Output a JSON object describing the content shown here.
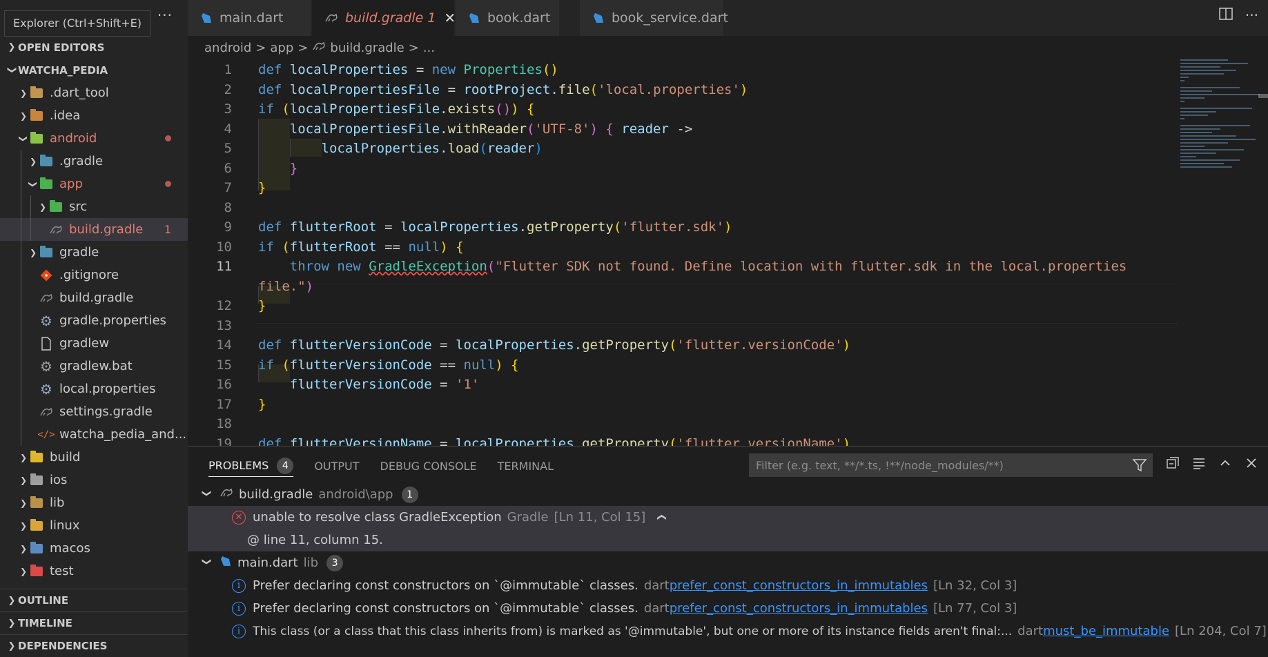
{
  "sidebar": {
    "tooltip": "Explorer (Ctrl+Shift+E)",
    "more": "···",
    "open_editors": "OPEN EDITORS",
    "workspace": "WATCHA_PEDIA",
    "tree": [
      {
        "label": ".dart_tool",
        "icon": "folder-icon"
      },
      {
        "label": ".idea",
        "icon": "folder-idea-icon"
      },
      {
        "label": "android",
        "icon": "folder-android-icon"
      },
      {
        "label": ".gradle",
        "icon": "folder-gradle-icon"
      },
      {
        "label": "app",
        "icon": "folder-app-icon"
      },
      {
        "label": "src",
        "icon": "folder-src-icon"
      },
      {
        "label": "build.gradle",
        "icon": "gradle-file-icon",
        "count": "1"
      },
      {
        "label": "gradle",
        "icon": "folder-gradle-icon"
      },
      {
        "label": ".gitignore",
        "icon": "git-icon"
      },
      {
        "label": "build.gradle",
        "icon": "gradle-file-icon"
      },
      {
        "label": "gradle.properties",
        "icon": "gear-icon"
      },
      {
        "label": "gradlew",
        "icon": "file-icon"
      },
      {
        "label": "gradlew.bat",
        "icon": "gear-icon"
      },
      {
        "label": "local.properties",
        "icon": "gear-icon"
      },
      {
        "label": "settings.gradle",
        "icon": "gradle-file-icon"
      },
      {
        "label": "watcha_pedia_and...",
        "icon": "xml-icon"
      },
      {
        "label": "build",
        "icon": "folder-build-icon"
      },
      {
        "label": "ios",
        "icon": "folder-ios-icon"
      },
      {
        "label": "lib",
        "icon": "folder-lib-icon"
      },
      {
        "label": "linux",
        "icon": "folder-linux-icon"
      },
      {
        "label": "macos",
        "icon": "folder-macos-icon"
      },
      {
        "label": "test",
        "icon": "folder-test-icon"
      }
    ],
    "outline": "OUTLINE",
    "timeline": "TIMELINE",
    "dependencies": "DEPENDENCIES"
  },
  "tabs": [
    {
      "label": "main.dart"
    },
    {
      "label": "build.gradle",
      "count": "1",
      "close": "✕"
    },
    {
      "label": "book.dart"
    },
    {
      "label": "book_service.dart"
    }
  ],
  "breadcrumb": {
    "p1": "android",
    "p2": "app",
    "p3": "build.gradle",
    "p4": "...",
    "sep": ">"
  },
  "editor": {
    "line_numbers": [
      "1",
      "2",
      "3",
      "4",
      "5",
      "6",
      "7",
      "8",
      "9",
      "10",
      "11",
      "12",
      "13",
      "14",
      "15",
      "16",
      "17",
      "18",
      "19"
    ],
    "lines": {
      "l1": [
        "def",
        "localProperties",
        "=",
        "new",
        "Properties",
        "(",
        ")"
      ],
      "l2": [
        "def",
        "localPropertiesFile",
        "=",
        "rootProject",
        ".",
        "file",
        "(",
        "'local.properties'",
        ")"
      ],
      "l3": [
        "if",
        "(",
        "localPropertiesFile",
        ".",
        "exists",
        "(",
        ")",
        ")",
        "{"
      ],
      "l4": [
        "localPropertiesFile",
        ".",
        "withReader",
        "(",
        "'UTF-8'",
        ")",
        "{",
        "reader",
        "->"
      ],
      "l5": [
        "localProperties",
        ".",
        "load",
        "(",
        "reader",
        ")"
      ],
      "l6": [
        "}"
      ],
      "l7": [
        "}"
      ],
      "l9": [
        "def",
        "flutterRoot",
        "=",
        "localProperties",
        ".",
        "getProperty",
        "(",
        "'flutter.sdk'",
        ")"
      ],
      "l10": [
        "if",
        "(",
        "flutterRoot",
        "==",
        "null",
        ")",
        "{"
      ],
      "l11": [
        "throw",
        "new",
        "GradleException",
        "(",
        "\"Flutter SDK not found. Define location with flutter.sdk in the local.properties"
      ],
      "l11b": [
        "file.\"",
        ")"
      ],
      "l12": [
        "}"
      ],
      "l14": [
        "def",
        "flutterVersionCode",
        "=",
        "localProperties",
        ".",
        "getProperty",
        "(",
        "'flutter.versionCode'",
        ")"
      ],
      "l15": [
        "if",
        "(",
        "flutterVersionCode",
        "==",
        "null",
        ")",
        "{"
      ],
      "l16": [
        "flutterVersionCode",
        "=",
        "'1'"
      ],
      "l17": [
        "}"
      ],
      "l19": [
        "def",
        "flutterVersionName",
        "=",
        "localProperties",
        ".",
        "getProperty",
        "(",
        "'flutter.versionName'",
        ")"
      ]
    }
  },
  "panel": {
    "tabs": {
      "problems": "PROBLEMS",
      "problems_count": "4",
      "output": "OUTPUT",
      "debug": "DEBUG CONSOLE",
      "terminal": "TERMINAL"
    },
    "filter_placeholder": "Filter (e.g. text, **/*.ts, !**/node_modules/**)",
    "groups": [
      {
        "file": "build.gradle",
        "path": "android\\app",
        "count": "1"
      },
      {
        "file": "main.dart",
        "path": "lib",
        "count": "3"
      }
    ],
    "problems": [
      {
        "message": "unable to resolve class GradleException",
        "source": "Gradle",
        "location": "[Ln 11, Col 15]",
        "detail": "@ line 11, column 15."
      },
      {
        "message": "Prefer declaring const constructors on `@immutable` classes.",
        "source": "dart",
        "code": "prefer_const_constructors_in_immutables",
        "location": "[Ln 32, Col 3]"
      },
      {
        "message": "Prefer declaring const constructors on `@immutable` classes.",
        "source": "dart",
        "code": "prefer_const_constructors_in_immutables",
        "location": "[Ln 77, Col 3]"
      },
      {
        "message": "This class (or a class that this class inherits from) is marked as '@immutable', but one or more of its instance fields aren't final:...",
        "source": "dart",
        "code": "must_be_immutable",
        "location": "[Ln 204, Col 7]"
      }
    ]
  }
}
